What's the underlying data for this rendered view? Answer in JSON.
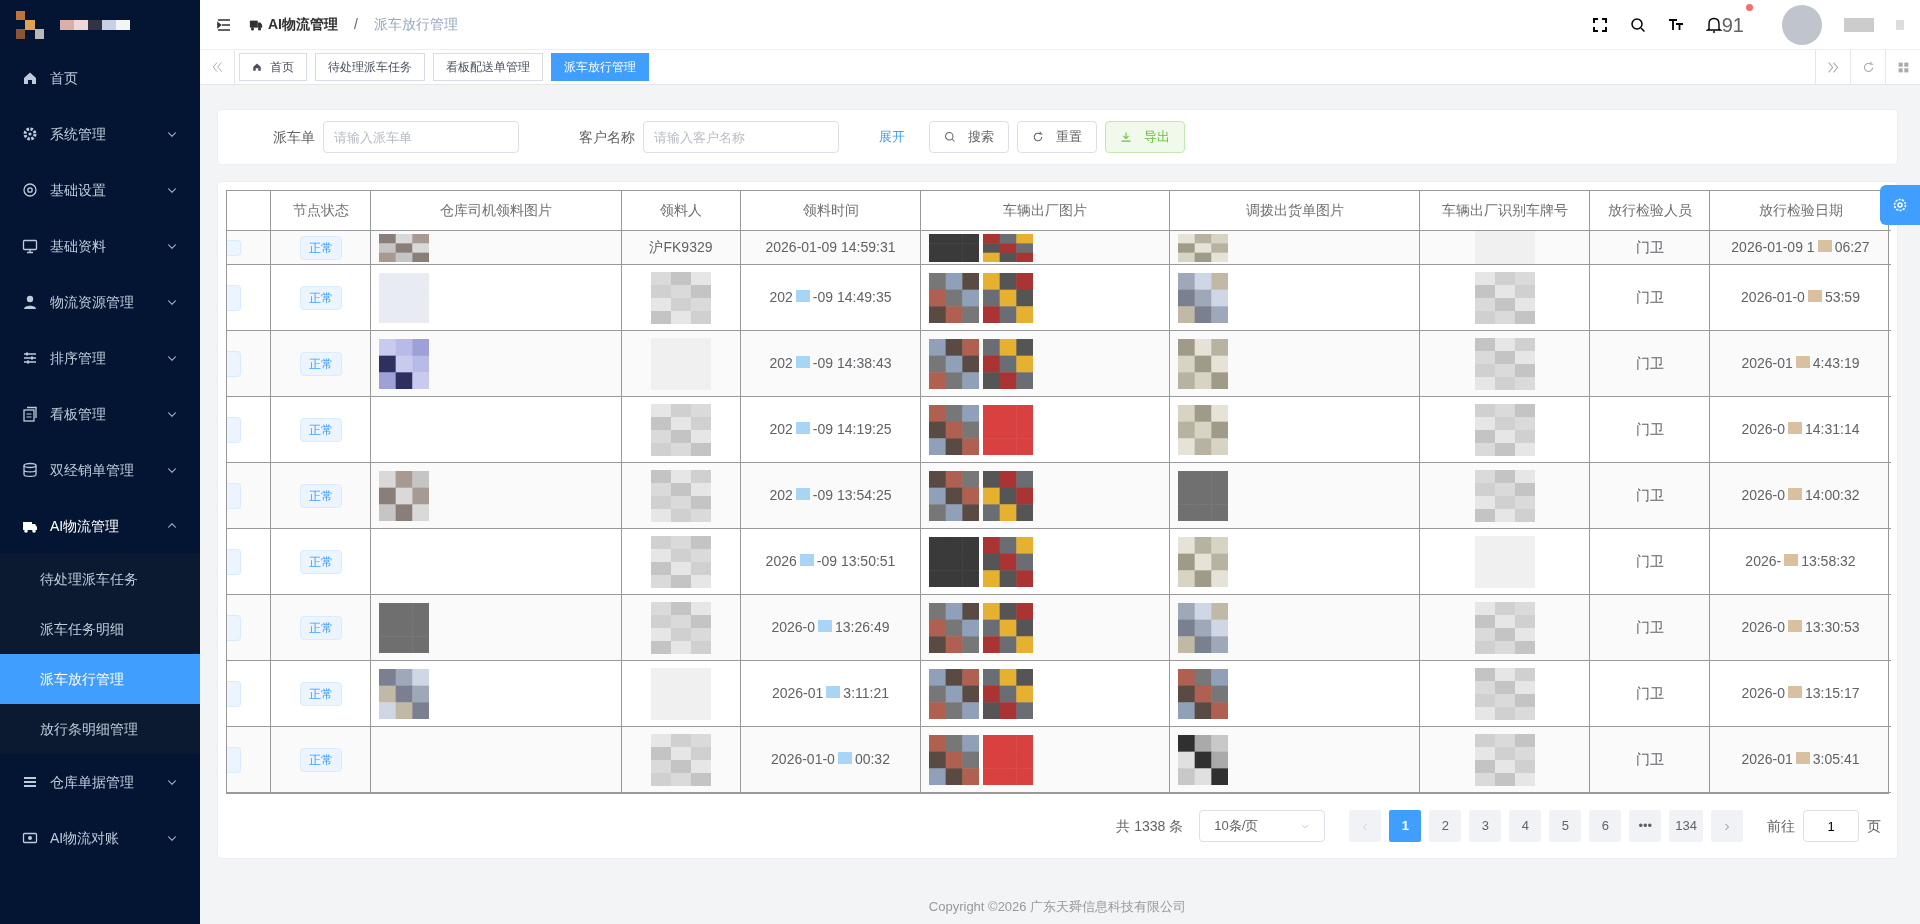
{
  "header": {
    "separator": "/",
    "breadcrumb": [
      {
        "label": "AI物流管理"
      },
      {
        "label": "派车放行管理"
      }
    ],
    "notification_count": "91"
  },
  "sidebar": {
    "items": [
      {
        "label": "首页"
      },
      {
        "label": "系统管理",
        "expanded": false
      },
      {
        "label": "基础设置",
        "expanded": false
      },
      {
        "label": "基础资料",
        "expanded": false
      },
      {
        "label": "物流资源管理",
        "expanded": false
      },
      {
        "label": "排序管理",
        "expanded": false
      },
      {
        "label": "看板管理",
        "expanded": false
      },
      {
        "label": "双经销单管理",
        "expanded": false
      },
      {
        "label": "AI物流管理",
        "expanded": true,
        "children": [
          {
            "label": "待处理派车任务",
            "selected": false
          },
          {
            "label": "派车任务明细",
            "selected": false
          },
          {
            "label": "派车放行管理",
            "selected": true
          },
          {
            "label": "放行条明细管理",
            "selected": false
          }
        ]
      },
      {
        "label": "仓库单据管理",
        "expanded": false
      },
      {
        "label": "AI物流对账",
        "expanded": false
      }
    ]
  },
  "tabs": [
    {
      "label": "首页",
      "selected": false
    },
    {
      "label": "待处理派车任务",
      "selected": false
    },
    {
      "label": "看板配送单管理",
      "selected": false
    },
    {
      "label": "派车放行管理",
      "selected": true
    }
  ],
  "filters": [
    {
      "label": "派车单",
      "placeholder": "请输入派车单"
    },
    {
      "label": "客户名称",
      "placeholder": "请输入客户名称"
    }
  ],
  "filter_actions": {
    "expand": "展开",
    "buttons": [
      {
        "kind": "search",
        "label": "搜索"
      },
      {
        "kind": "reset",
        "label": "重置"
      },
      {
        "kind": "export",
        "label": "导出"
      }
    ]
  },
  "table": {
    "columns": [
      "节点状态",
      "仓库司机领料图片",
      "领料人",
      "领料时间",
      "车辆出厂图片",
      "调拨出货单图片",
      "车辆出厂识别车牌号",
      "放行检验人员",
      "放行检验日期"
    ],
    "rows": [
      {
        "status": "正常",
        "driver_photo": true,
        "receiver": "沪FK9329",
        "receive_time": [
          "2026-01-09 14:59:31"
        ],
        "inspector": "门卫",
        "inspect_date": [
          "2026-01-09 1",
          "06:27"
        ]
      },
      {
        "status": "正常",
        "driver_photo": true,
        "receive_time": [
          "202",
          "-09 14:49:35"
        ],
        "inspector": "门卫",
        "inspect_date": [
          "2026-01-0",
          "53:59"
        ]
      },
      {
        "status": "正常",
        "driver_photo": true,
        "receive_time": [
          "202",
          "-09 14:38:43"
        ],
        "inspector": "门卫",
        "inspect_date": [
          "2026-01",
          "4:43:19"
        ]
      },
      {
        "status": "正常",
        "driver_photo": false,
        "receive_time": [
          "202",
          "-09 14:19:25"
        ],
        "inspector": "门卫",
        "inspect_date": [
          "2026-0",
          "14:31:14"
        ]
      },
      {
        "status": "正常",
        "driver_photo": true,
        "receive_time": [
          "202",
          "-09 13:54:25"
        ],
        "inspector": "门卫",
        "inspect_date": [
          "2026-0",
          "14:00:32"
        ]
      },
      {
        "status": "正常",
        "driver_photo": false,
        "receive_time": [
          "2026",
          "-09 13:50:51"
        ],
        "inspector": "门卫",
        "inspect_date": [
          "2026-",
          "13:58:32"
        ]
      },
      {
        "status": "正常",
        "driver_photo": true,
        "receive_time": [
          "2026-0",
          "13:26:49"
        ],
        "inspector": "门卫",
        "inspect_date": [
          "2026-0",
          "13:30:53"
        ]
      },
      {
        "status": "正常",
        "driver_photo": true,
        "receive_time": [
          "2026-01",
          "3:11:21"
        ],
        "inspector": "门卫",
        "inspect_date": [
          "2026-0",
          "13:15:17"
        ]
      },
      {
        "status": "正常",
        "driver_photo": false,
        "receive_time": [
          "2026-01-0",
          "00:32"
        ],
        "inspector": "门卫",
        "inspect_date": [
          "2026-01",
          "3:05:41"
        ]
      }
    ]
  },
  "pagination": {
    "total": "共 1338 条",
    "page_size": "10条/页",
    "pages": [
      {
        "label": "1",
        "selected": true
      },
      {
        "label": "2",
        "selected": false
      },
      {
        "label": "3",
        "selected": false
      },
      {
        "label": "4",
        "selected": false
      },
      {
        "label": "5",
        "selected": false
      },
      {
        "label": "6",
        "selected": false
      },
      {
        "label": "•••",
        "selected": false
      },
      {
        "label": "134",
        "selected": false
      }
    ],
    "jump_label": "前往",
    "jump_value": "1",
    "jump_suffix": "页"
  },
  "footer": "Copyright ©2026 广东天舜信息科技有限公司"
}
